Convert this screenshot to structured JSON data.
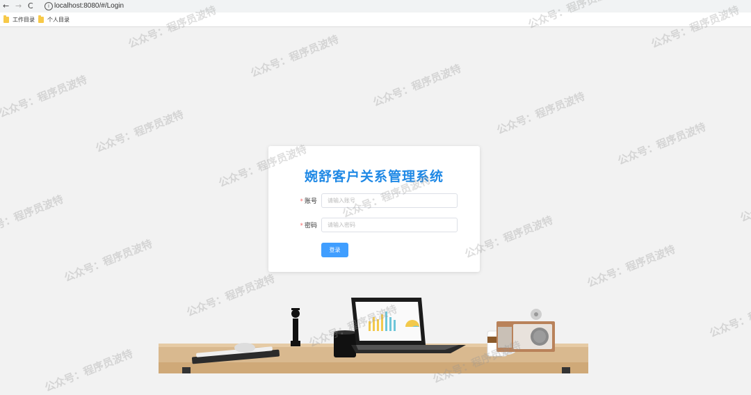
{
  "browser": {
    "back": "←",
    "forward": "→",
    "reload": "C",
    "url": "localhost:8080/#/Login",
    "bookmarks": [
      {
        "label": "工作目录"
      },
      {
        "label": "个人目录"
      }
    ]
  },
  "login": {
    "title": "婉舒客户关系管理系统",
    "account_label": "账号",
    "account_placeholder": "请输入账号",
    "password_label": "密码",
    "password_placeholder": "请输入密码",
    "required_mark": "*",
    "submit_label": "登录"
  },
  "watermark": {
    "text": "公众号：程序员波特"
  },
  "colors": {
    "accent": "#409eff",
    "title": "#1e88e5",
    "required": "#f56c6c",
    "background": "#f2f2f2"
  }
}
